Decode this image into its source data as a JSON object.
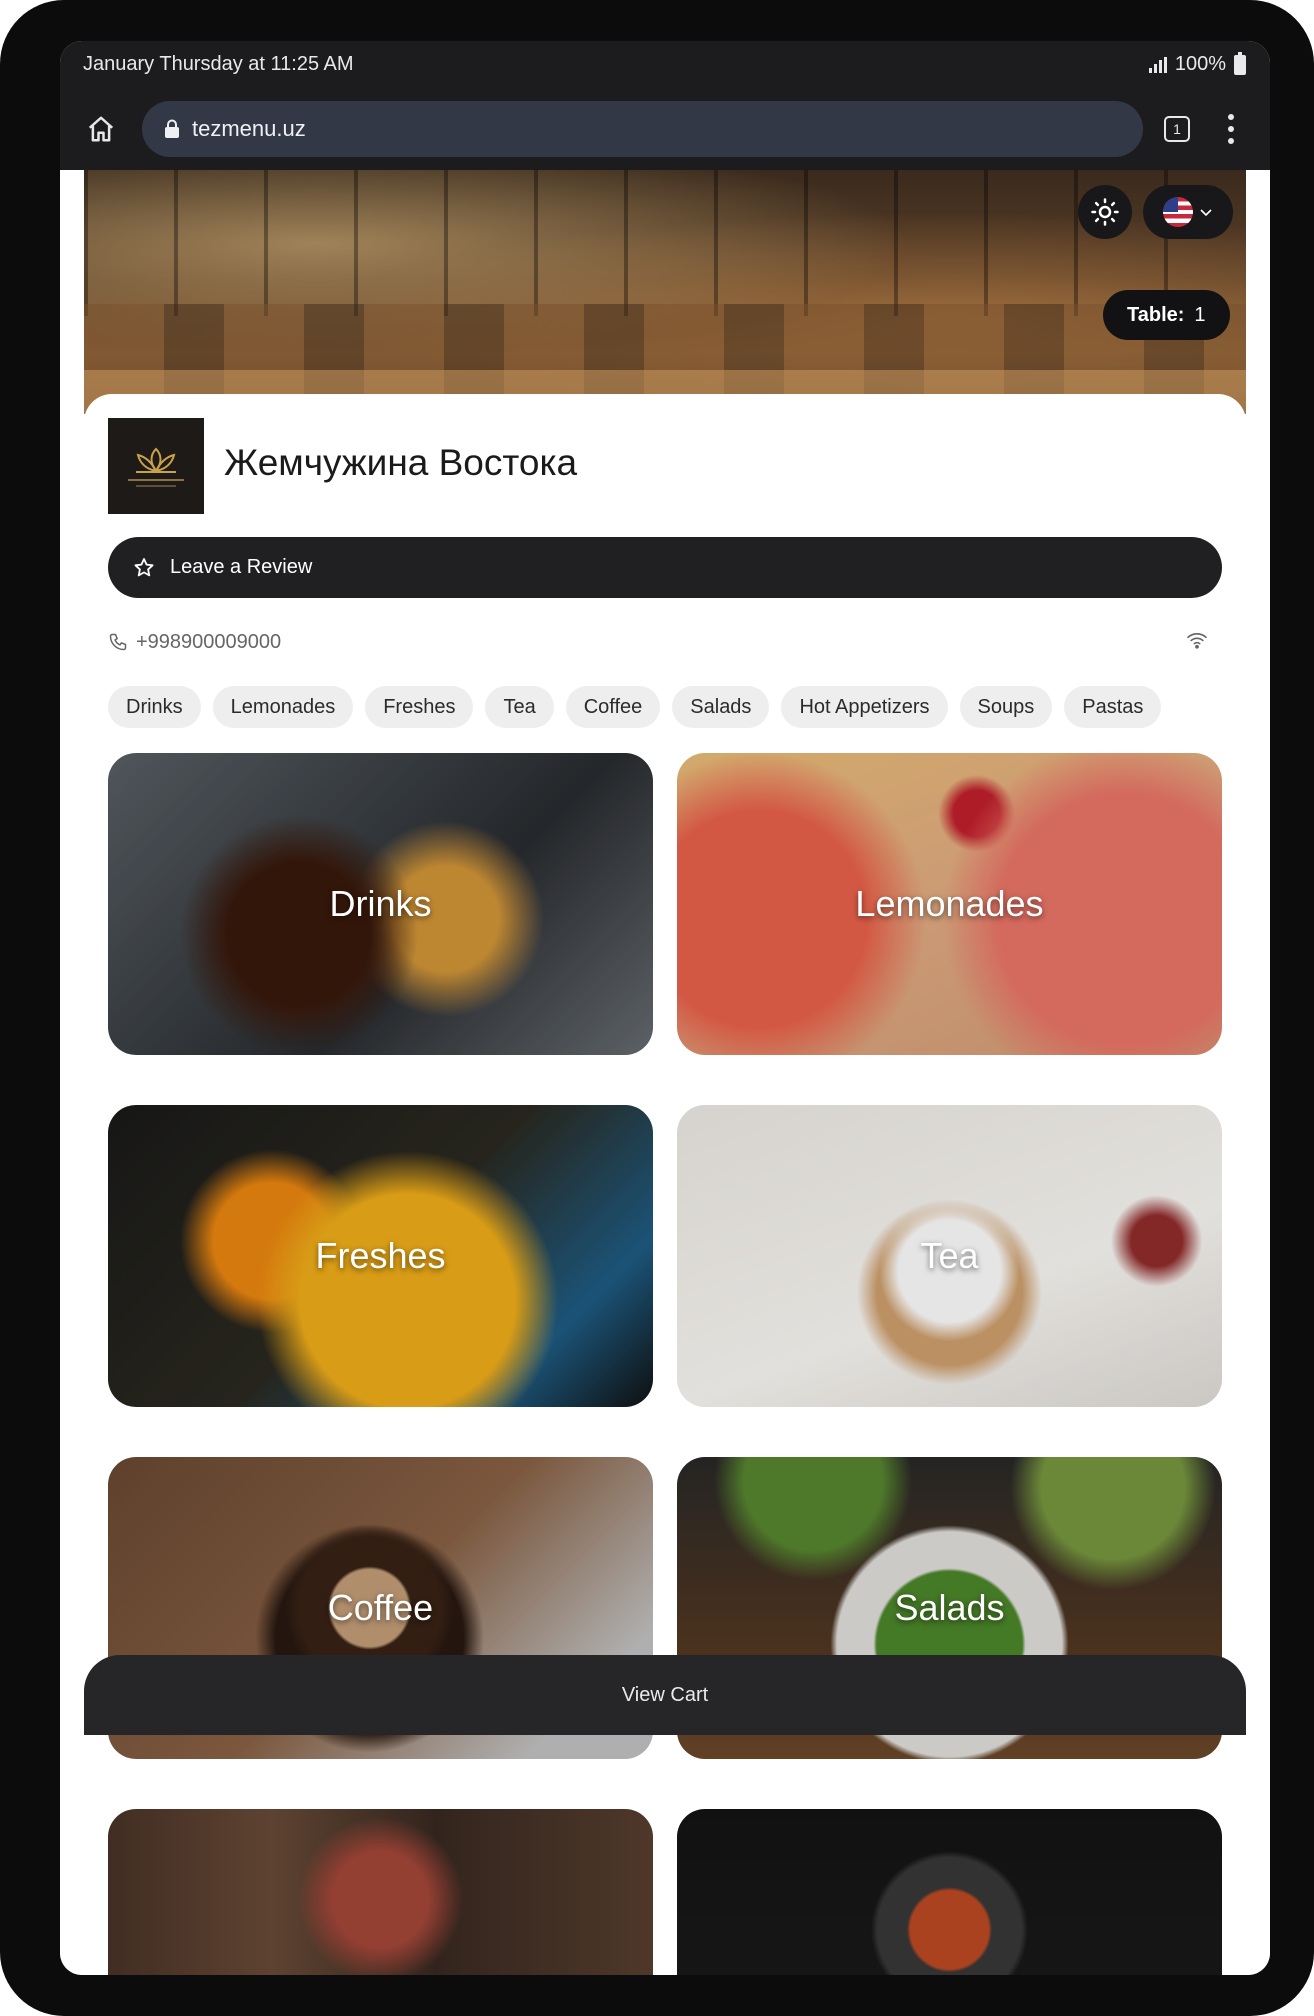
{
  "status_bar": {
    "datetime": "January Thursday at 11:25 AM",
    "battery": "100%"
  },
  "browser": {
    "url": "tezmenu.uz",
    "tab_count": "1"
  },
  "hero": {
    "table_label": "Table:",
    "table_number": "1"
  },
  "restaurant": {
    "name": "Жемчужина Востока",
    "review_label": "Leave a Review",
    "phone": "+998900009000"
  },
  "categories": [
    "Drinks",
    "Lemonades",
    "Freshes",
    "Tea",
    "Coffee",
    "Salads",
    "Hot Appetizers",
    "Soups",
    "Pastas"
  ],
  "tiles": [
    {
      "label": "Drinks"
    },
    {
      "label": "Lemonades"
    },
    {
      "label": "Freshes"
    },
    {
      "label": "Tea"
    },
    {
      "label": "Coffee"
    },
    {
      "label": "Salads"
    },
    {
      "label": ""
    },
    {
      "label": ""
    }
  ],
  "cart": {
    "label": "View Cart"
  },
  "colors": {
    "dark": "#202022",
    "chip": "#eeeeee",
    "bar": "#1c1c1e",
    "url_bar": "#333846"
  }
}
